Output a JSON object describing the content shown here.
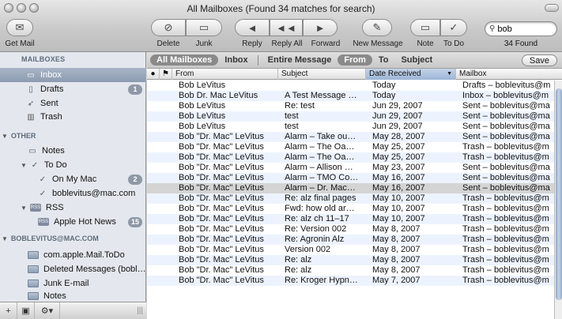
{
  "window": {
    "title": "All Mailboxes (Found 34 matches for search)"
  },
  "toolbar": {
    "get_mail": "Get Mail",
    "delete": "Delete",
    "junk": "Junk",
    "reply": "Reply",
    "reply_all": "Reply All",
    "forward": "Forward",
    "new_message": "New Message",
    "note": "Note",
    "todo": "To Do",
    "search_value": "bob",
    "found": "34 Found"
  },
  "sidebar": {
    "mailboxes_heading": "MAILBOXES",
    "inbox": "Inbox",
    "drafts": "Drafts",
    "drafts_badge": "1",
    "sent": "Sent",
    "trash": "Trash",
    "other_heading": "OTHER",
    "notes": "Notes",
    "todo": "To Do",
    "on_my_mac": "On My Mac",
    "on_my_mac_badge": "2",
    "boblevitus_todo": "boblevitus@mac.com",
    "rss": "RSS",
    "apple_hot_news": "Apple Hot News",
    "apple_hot_news_badge": "15",
    "account_heading": "BOBLEVITUS@MAC.COM",
    "account_folders": [
      "com.apple.Mail.ToDo",
      "Deleted Messages (bobl…",
      "Junk E-mail",
      "Notes"
    ]
  },
  "scope": {
    "all_mailboxes": "All Mailboxes",
    "inbox": "Inbox",
    "entire_message": "Entire Message",
    "from": "From",
    "to": "To",
    "subject": "Subject",
    "save": "Save"
  },
  "columns": {
    "from": "From",
    "subject": "Subject",
    "date": "Date Received",
    "mailbox": "Mailbox"
  },
  "messages": [
    {
      "from": "Bob LeVitus",
      "subject": "",
      "date": "Today",
      "mailbox": "Drafts – boblevitus@m"
    },
    {
      "from": "Bob Dr. Mac LeVitus",
      "subject": "A Test Message …",
      "date": "Today",
      "mailbox": "Inbox – boblevitus@m"
    },
    {
      "from": "Bob LeVitus",
      "subject": "Re: test",
      "date": "Jun 29, 2007",
      "mailbox": "Sent – boblevitus@ma"
    },
    {
      "from": "Bob LeVitus",
      "subject": "test",
      "date": "Jun 29, 2007",
      "mailbox": "Sent – boblevitus@ma"
    },
    {
      "from": "Bob LeVitus",
      "subject": "test",
      "date": "Jun 29, 2007",
      "mailbox": "Sent – boblevitus@ma"
    },
    {
      "from": "Bob \"Dr. Mac\" LeVitus",
      "subject": "Alarm – Take ou…",
      "date": "May 28, 2007",
      "mailbox": "Sent – boblevitus@ma"
    },
    {
      "from": "Bob \"Dr. Mac\" LeVitus",
      "subject": "Alarm – The Oa…",
      "date": "May 25, 2007",
      "mailbox": "Trash – boblevitus@m"
    },
    {
      "from": "Bob \"Dr. Mac\" LeVitus",
      "subject": "Alarm – The Oa…",
      "date": "May 25, 2007",
      "mailbox": "Trash – boblevitus@m"
    },
    {
      "from": "Bob \"Dr. Mac\" LeVitus",
      "subject": "Alarm – Allison …",
      "date": "May 23, 2007",
      "mailbox": "Sent – boblevitus@ma"
    },
    {
      "from": "Bob \"Dr. Mac\" LeVitus",
      "subject": "Alarm – TMO Co…",
      "date": "May 16, 2007",
      "mailbox": "Sent – boblevitus@ma"
    },
    {
      "from": "Bob \"Dr. Mac\" LeVitus",
      "subject": "Alarm – Dr. Mac…",
      "date": "May 16, 2007",
      "mailbox": "Sent – boblevitus@ma"
    },
    {
      "from": "Bob \"Dr. Mac\" LeVitus",
      "subject": "Re: alz final pages",
      "date": "May 10, 2007",
      "mailbox": "Trash – boblevitus@m"
    },
    {
      "from": "Bob \"Dr. Mac\" LeVitus",
      "subject": "Fwd: how old ar…",
      "date": "May 10, 2007",
      "mailbox": "Trash – boblevitus@m"
    },
    {
      "from": "Bob \"Dr. Mac\" LeVitus",
      "subject": "Re: alz ch 11–17",
      "date": "May 10, 2007",
      "mailbox": "Trash – boblevitus@m"
    },
    {
      "from": "Bob \"Dr. Mac\" LeVitus",
      "subject": "Re: Version 002",
      "date": "May 8, 2007",
      "mailbox": "Trash – boblevitus@m"
    },
    {
      "from": "Bob \"Dr. Mac\" LeVitus",
      "subject": "Re: Agronin Alz",
      "date": "May 8, 2007",
      "mailbox": "Trash – boblevitus@m"
    },
    {
      "from": "Bob \"Dr. Mac\" LeVitus",
      "subject": "Version 002",
      "date": "May 8, 2007",
      "mailbox": "Trash – boblevitus@m"
    },
    {
      "from": "Bob \"Dr. Mac\" LeVitus",
      "subject": "Re: alz",
      "date": "May 8, 2007",
      "mailbox": "Trash – boblevitus@m"
    },
    {
      "from": "Bob \"Dr. Mac\" LeVitus",
      "subject": "Re: alz",
      "date": "May 8, 2007",
      "mailbox": "Trash – boblevitus@m"
    },
    {
      "from": "Bob \"Dr. Mac\" LeVitus",
      "subject": "Re: Kroger Hypn…",
      "date": "May 7, 2007",
      "mailbox": "Trash – boblevitus@m"
    }
  ],
  "selected_row": 10,
  "colors": {
    "selection": "#d4d4d4",
    "alt_row": "#edf3fe",
    "sidebar_bg": "#e4e8ee"
  }
}
